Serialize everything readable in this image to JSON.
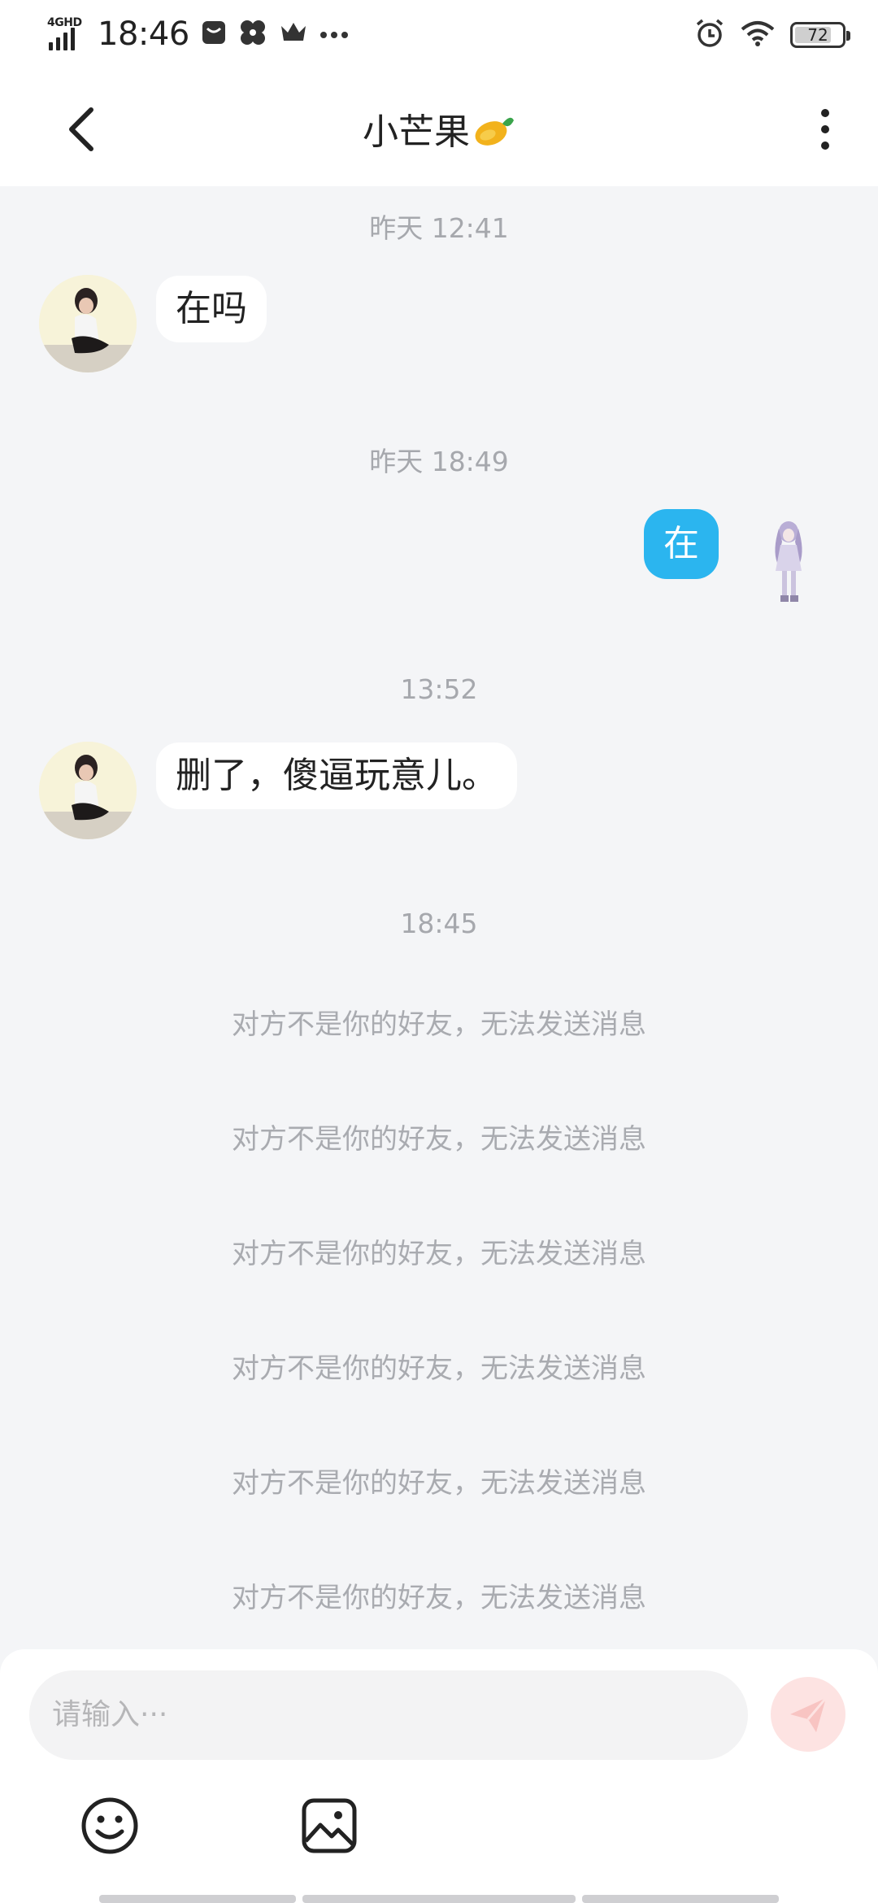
{
  "status_bar": {
    "network": "4GHD",
    "time": "18:46",
    "battery": "72"
  },
  "header": {
    "title": "小芒果"
  },
  "messages": {
    "ts1": "昨天 12:41",
    "msg1": "在吗",
    "ts2": "昨天 18:49",
    "msg2": "在",
    "ts3": "13:52",
    "msg3": "删了，傻逼玩意儿。",
    "ts4": "18:45",
    "system_notices": [
      "对方不是你的好友，无法发送消息",
      "对方不是你的好友，无法发送消息",
      "对方不是你的好友，无法发送消息",
      "对方不是你的好友，无法发送消息",
      "对方不是你的好友，无法发送消息",
      "对方不是你的好友，无法发送消息"
    ]
  },
  "input": {
    "placeholder": "请输入···"
  },
  "icons": {
    "back": "chevron-left-icon",
    "more": "more-vertical-icon",
    "send": "send-icon",
    "emoji": "smiley-icon",
    "image": "image-icon"
  },
  "colors": {
    "outgoing_bubble": "#2bb5ef",
    "background": "#f4f5f7",
    "send_button": "#fde3e2"
  }
}
